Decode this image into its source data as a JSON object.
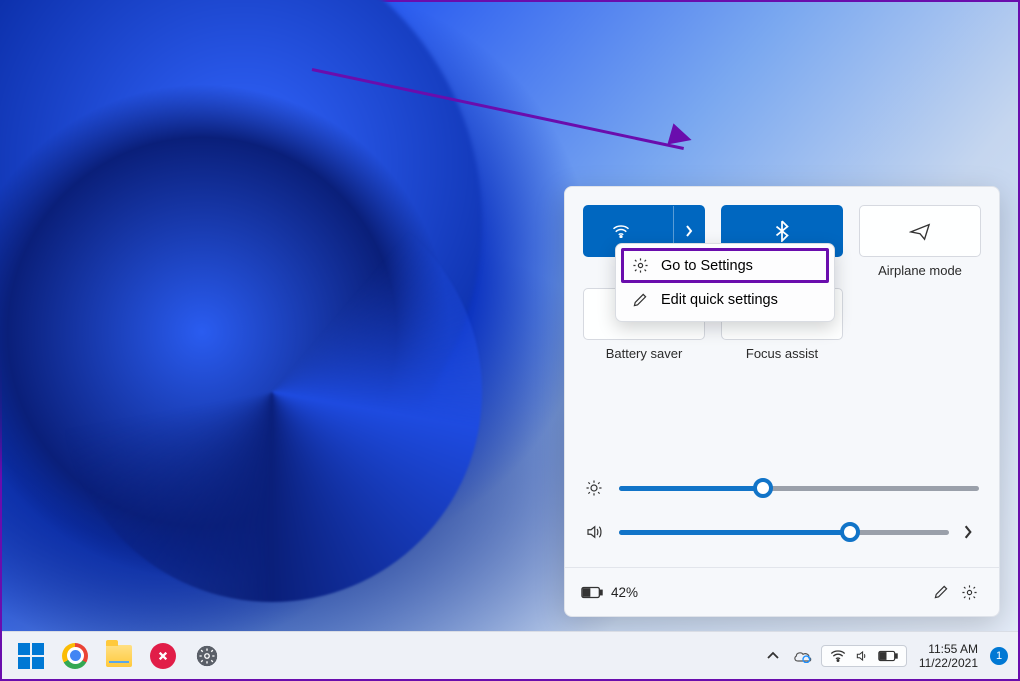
{
  "quick_settings": {
    "tiles": {
      "wifi": {
        "label": "",
        "active": true
      },
      "bluetooth": {
        "label": "",
        "active": true
      },
      "airplane": {
        "label": "Airplane mode",
        "active": false
      },
      "battery_saver": {
        "label": "Battery saver",
        "active": false
      },
      "focus_assist": {
        "label": "Focus assist",
        "active": false
      }
    },
    "context_menu": {
      "go_to_settings": "Go to Settings",
      "edit_quick_settings": "Edit quick settings"
    },
    "sliders": {
      "brightness_percent": 40,
      "volume_percent": 70
    },
    "footer": {
      "battery_text": "42%"
    }
  },
  "taskbar": {
    "clock_time": "11:55 AM",
    "clock_date": "11/22/2021",
    "notification_count": "1"
  },
  "colors": {
    "accent": "#0067c0",
    "highlight": "#6a0dad"
  }
}
